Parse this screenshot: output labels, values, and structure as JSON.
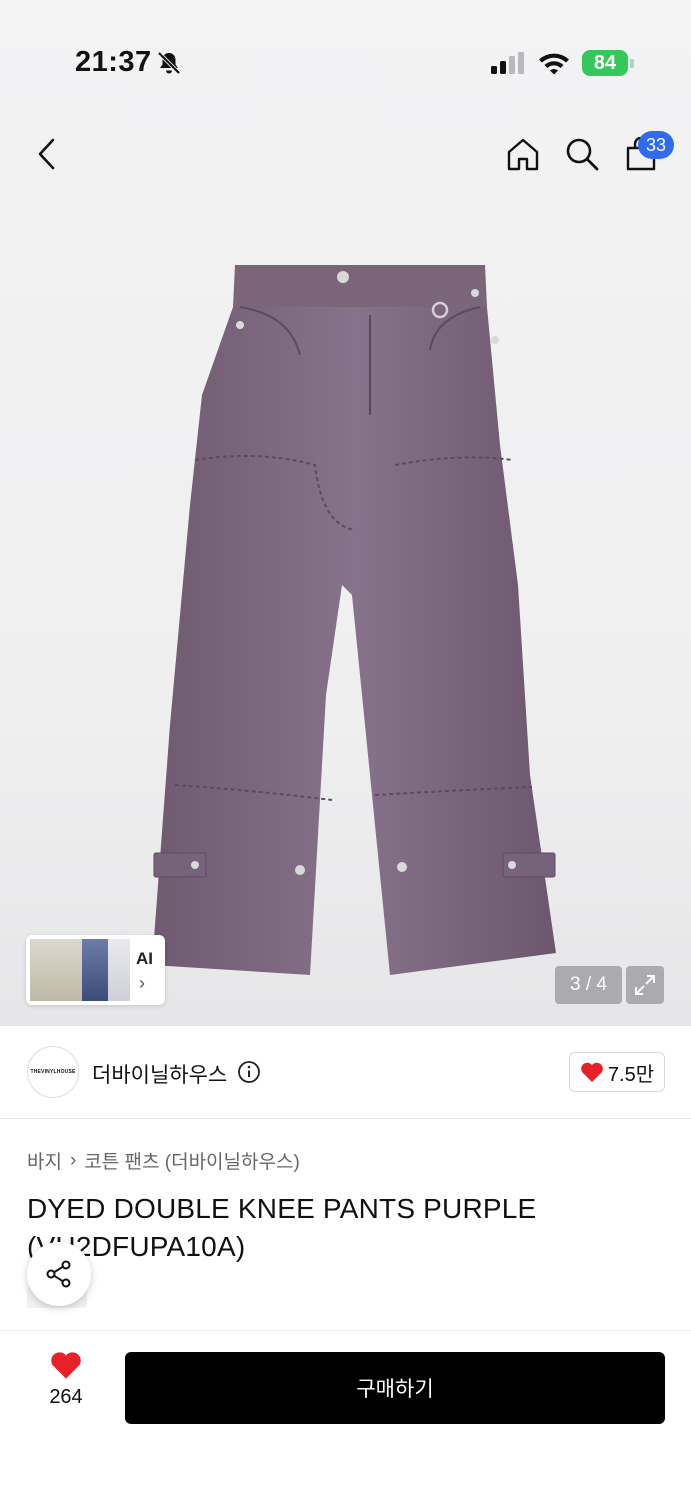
{
  "status_bar": {
    "time": "21:37",
    "battery": "84"
  },
  "nav": {
    "cart_count": "33",
    "icons": [
      "back-arrow-icon",
      "home-icon",
      "search-icon",
      "cart-icon"
    ]
  },
  "gallery": {
    "counter": "3 / 4",
    "ai_label": "AI",
    "ai_chevron": "›",
    "product_color": "#7f6a7f"
  },
  "brand": {
    "logo_text": "THEVINYLHOUSE",
    "name": "더바이닐하우스",
    "likes": "7.5만",
    "like_color": "#e8202a"
  },
  "breadcrumb": {
    "category": "바지",
    "separator": "›",
    "subcategory": "코튼 팬츠 (더바이닐하우스)"
  },
  "product": {
    "title": "DYED DOUBLE KNEE PANTS PURPLE (VH2DFUPA10A)"
  },
  "bottom": {
    "wish_count": "264",
    "buy_label": "구매하기",
    "buy_color": "#000000"
  }
}
